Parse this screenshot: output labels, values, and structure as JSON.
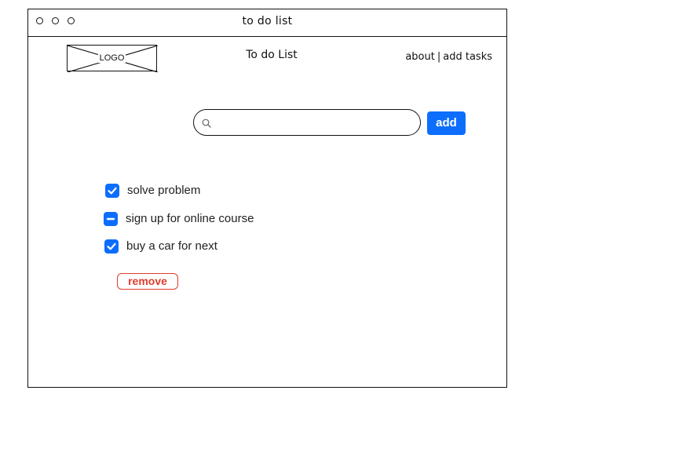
{
  "window": {
    "title": "to do list"
  },
  "header": {
    "logo_label": "LOGO",
    "page_title": "To do List",
    "nav": {
      "about": "about",
      "separator": "|",
      "add_tasks": "add tasks"
    }
  },
  "search": {
    "value": "",
    "placeholder": "",
    "icon": "search-icon"
  },
  "add_button": {
    "label": "add"
  },
  "todos": [
    {
      "label": "solve problem",
      "state": "checked"
    },
    {
      "label": "sign up for online course",
      "state": "indeterminate"
    },
    {
      "label": "buy a car for next",
      "state": "checked"
    }
  ],
  "remove_button": {
    "label": "remove"
  },
  "colors": {
    "accent": "#0d6efd",
    "danger": "#e03c2c",
    "ink": "#111111"
  }
}
